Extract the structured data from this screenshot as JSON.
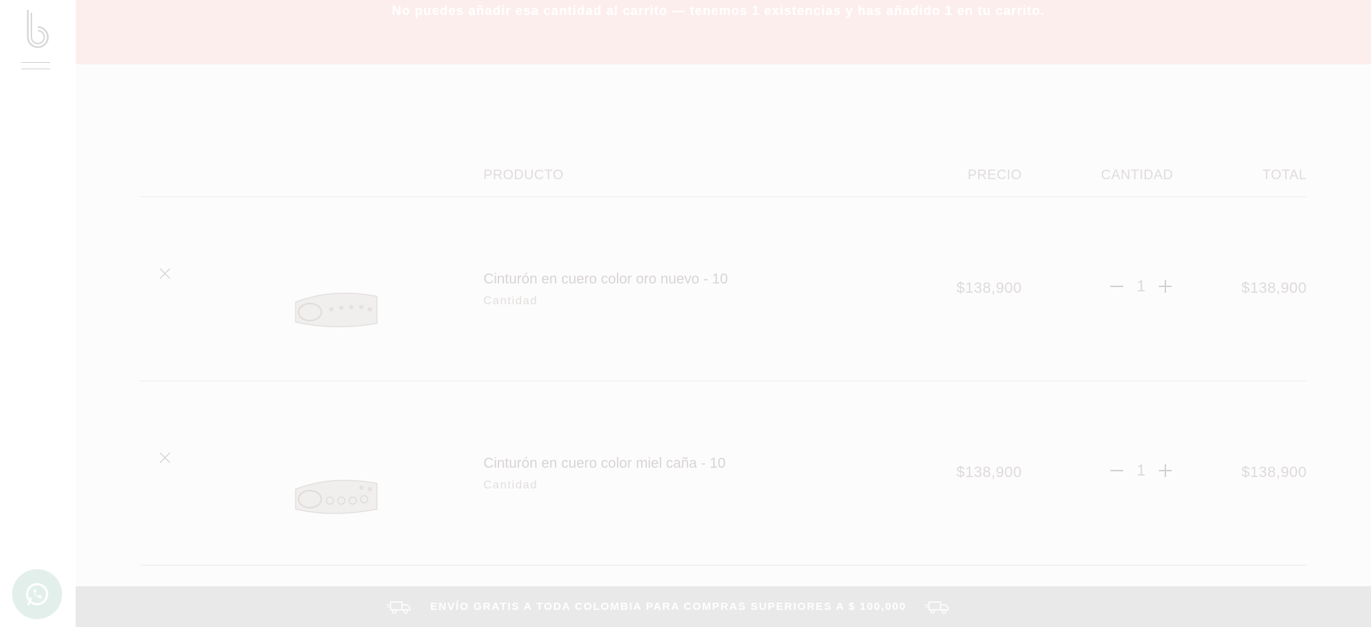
{
  "brand": {
    "logo_icon": "b-logo-icon"
  },
  "menu": {
    "icon": "hamburger-icon"
  },
  "notice": {
    "text": "No puedes añadir esa cantidad al carrito — tenemos 1 existencias y has añadido 1 en tu carrito.",
    "background": "#fdeeee"
  },
  "cart": {
    "headers": {
      "product": "PRODUCTO",
      "price": "PRECIO",
      "quantity": "CANTIDAD",
      "total": "TOTAL"
    },
    "items": [
      {
        "name": "Cinturón en cuero color oro nuevo - 10",
        "qty_label": "Cantidad",
        "price": "$138,900",
        "quantity": "1",
        "total": "$138,900",
        "image_icon": "belt-image"
      },
      {
        "name": "Cinturón en cuero color miel caña - 10",
        "qty_label": "Cantidad",
        "price": "$138,900",
        "quantity": "1",
        "total": "$138,900",
        "image_icon": "belt-image"
      }
    ]
  },
  "shipping": {
    "text": "ENVÍO GRATIS A TODA COLOMBIA PARA COMPRAS SUPERIORES A $ 100,000",
    "icon": "truck-icon",
    "background": "#e9e9e9"
  },
  "whatsapp": {
    "icon": "whatsapp-icon",
    "color": "#e3efeb"
  }
}
